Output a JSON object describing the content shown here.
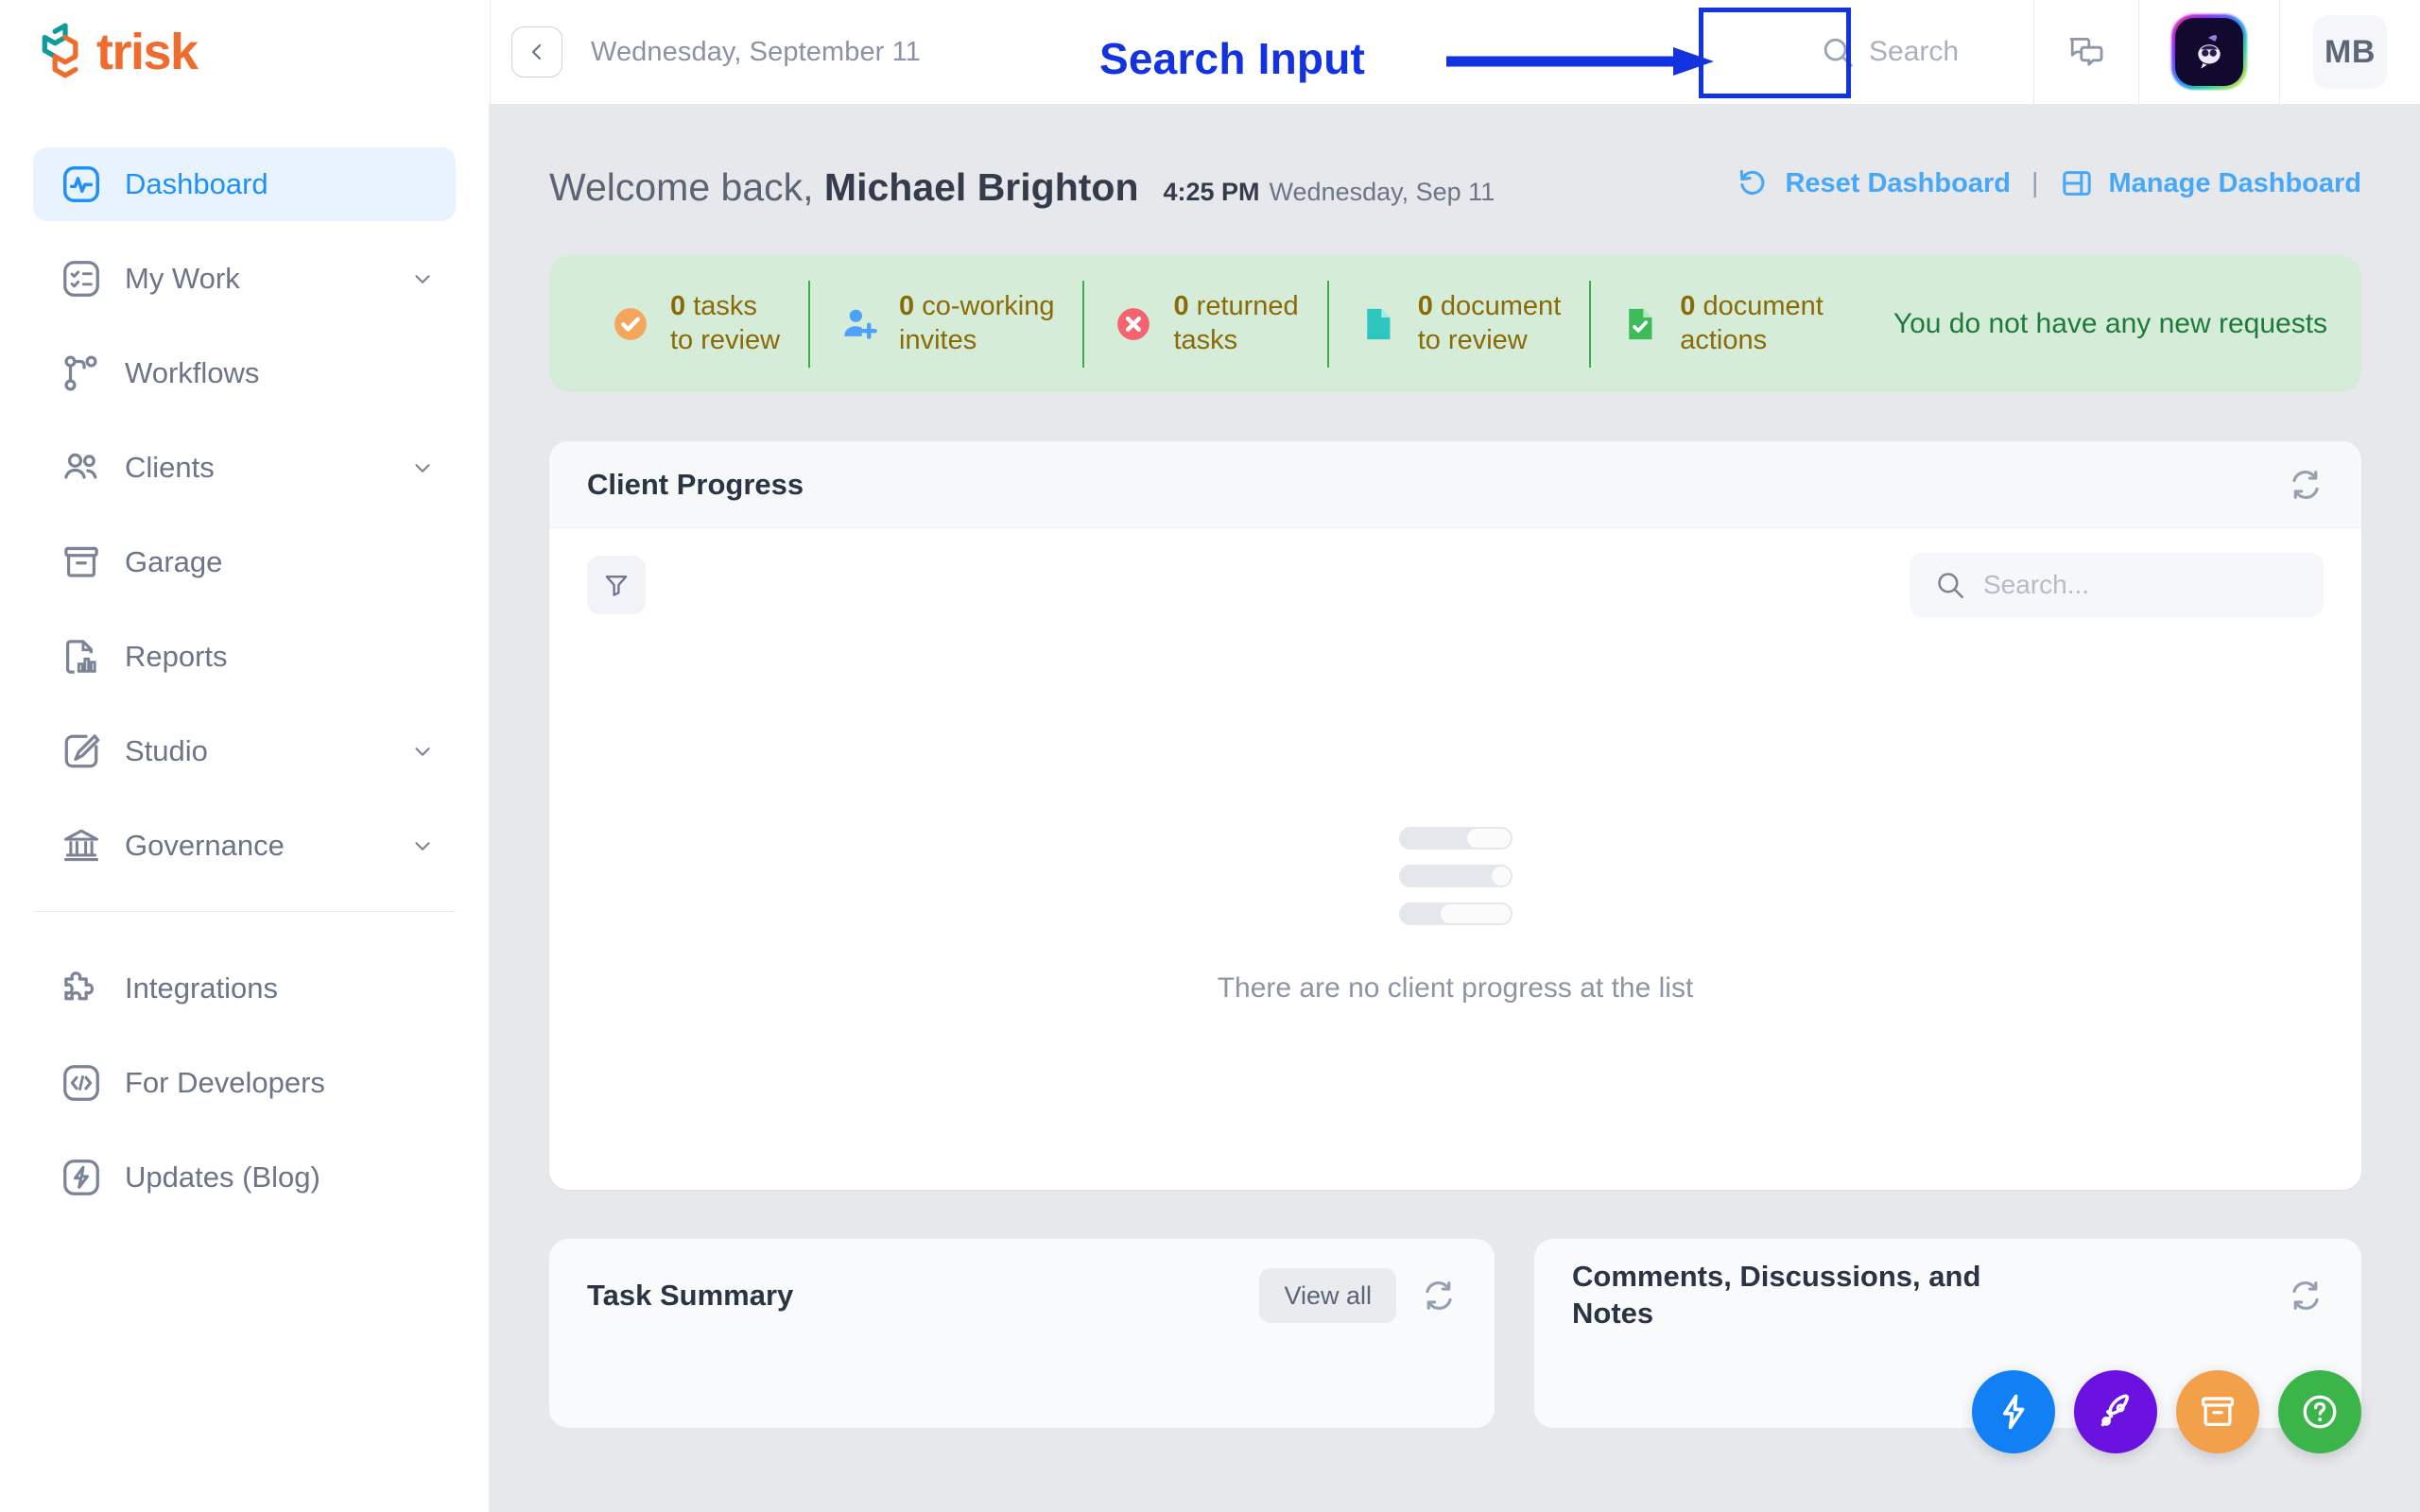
{
  "brand": {
    "name": "trisk",
    "accent": "#ee6c2d",
    "accent2": "#0f9b9b"
  },
  "topbar": {
    "date": "Wednesday, September 11",
    "collapse_icon": "chevron-left-icon",
    "search_placeholder": "Search",
    "search_icon": "search-icon",
    "chat_icon": "chat-bubbles-icon",
    "bot_icon": "ai-bot-avatar-icon",
    "user_initials": "MB"
  },
  "annotation": {
    "label": "Search Input",
    "color": "#1433e0"
  },
  "sidebar": {
    "items": [
      {
        "label": "Dashboard",
        "icon": "activity-pulse-icon",
        "active": true,
        "expandable": false
      },
      {
        "label": "My Work",
        "icon": "checklist-icon",
        "active": false,
        "expandable": true
      },
      {
        "label": "Workflows",
        "icon": "workflow-branch-icon",
        "active": false,
        "expandable": false
      },
      {
        "label": "Clients",
        "icon": "users-icon",
        "active": false,
        "expandable": true
      },
      {
        "label": "Garage",
        "icon": "archive-box-icon",
        "active": false,
        "expandable": false
      },
      {
        "label": "Reports",
        "icon": "document-chart-icon",
        "active": false,
        "expandable": false
      },
      {
        "label": "Studio",
        "icon": "brush-square-icon",
        "active": false,
        "expandable": true
      },
      {
        "label": "Governance",
        "icon": "bank-columns-icon",
        "active": false,
        "expandable": true
      }
    ],
    "secondary_items": [
      {
        "label": "Integrations",
        "icon": "puzzle-piece-icon"
      },
      {
        "label": "For Developers",
        "icon": "code-brackets-icon"
      },
      {
        "label": "Updates (Blog)",
        "icon": "lightning-bolt-icon"
      }
    ]
  },
  "header": {
    "greeting_prefix": "Welcome back,",
    "user_name": "Michael Brighton",
    "time": "4:25 PM",
    "date": "Wednesday, Sep 11",
    "reset_label": "Reset Dashboard",
    "reset_icon": "reset-arrow-icon",
    "divider": "|",
    "manage_label": "Manage Dashboard",
    "manage_icon": "layout-panels-icon",
    "link_color": "#48a8f8"
  },
  "status_bar": {
    "background": "#d5edd8",
    "text_color": "#8a6a07",
    "items": [
      {
        "count": "0",
        "line1": "tasks",
        "line2": "to review",
        "icon": "check-circle-icon",
        "icon_color": "#f5a55c"
      },
      {
        "count": "0",
        "line1": "co-working",
        "line2": "invites",
        "icon": "user-plus-icon",
        "icon_color": "#4da2f5"
      },
      {
        "count": "0",
        "line1": "returned",
        "line2": "tasks",
        "icon": "x-circle-icon",
        "icon_color": "#f4636f"
      },
      {
        "count": "0",
        "line1": "document",
        "line2": "to review",
        "icon": "document-icon",
        "icon_color": "#2ec7c0"
      },
      {
        "count": "0",
        "line1": "document",
        "line2": "actions",
        "icon": "document-check-icon",
        "icon_color": "#3fba5a"
      }
    ],
    "note": "You do not have any new requests",
    "note_color": "#1d7a3a"
  },
  "client_progress": {
    "title": "Client Progress",
    "refresh_icon": "refresh-icon",
    "filter_icon": "filter-funnel-icon",
    "search_placeholder": "Search...",
    "search_icon": "search-icon",
    "empty_message": "There are no client progress at the list"
  },
  "task_summary": {
    "title": "Task Summary",
    "view_all_label": "View all",
    "refresh_icon": "refresh-icon"
  },
  "comments_card": {
    "title": "Comments, Discussions, and Notes",
    "refresh_icon": "refresh-icon"
  },
  "fabs": [
    {
      "icon": "lightning-bolt-icon",
      "color": "#1180f5",
      "name": "quick-actions"
    },
    {
      "icon": "rocket-icon",
      "color": "#6b11e0",
      "name": "whats-new"
    },
    {
      "icon": "archive-box-icon",
      "color": "#f3a04b",
      "name": "garage"
    },
    {
      "icon": "question-circle-icon",
      "color": "#3bb54a",
      "name": "help"
    }
  ]
}
